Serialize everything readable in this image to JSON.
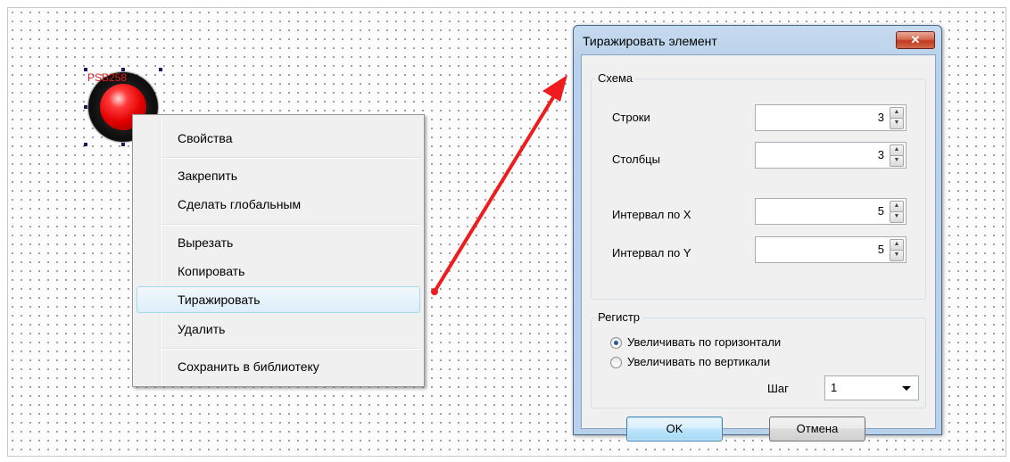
{
  "element": {
    "label": "PSB258"
  },
  "context_menu": {
    "items": [
      "Свойства",
      "Закрепить",
      "Сделать глобальным",
      "Вырезать",
      "Копировать",
      "Тиражировать",
      "Удалить",
      "Сохранить в библиотеку"
    ],
    "highlighted": "Тиражировать"
  },
  "dialog": {
    "title": "Тиражировать элемент",
    "close_glyph": "✕",
    "schema_group": "Схема",
    "rows_label": "Строки",
    "rows_value": "3",
    "cols_label": "Столбцы",
    "cols_value": "3",
    "interval_x_label": "Интервал по X",
    "interval_x_value": "5",
    "interval_y_label": "Интервал по Y",
    "interval_y_value": "5",
    "register_group": "Регистр",
    "radio_horizontal": "Увеличивать по горизонтали",
    "radio_vertical": "Увеличивать по вертикали",
    "step_label": "Шаг",
    "step_value": "1",
    "ok": "OK",
    "cancel": "Отмена"
  },
  "colors": {
    "arrow": "#ee1c1c",
    "lamp": "#e30000",
    "highlight_border": "#a8d8eb"
  }
}
